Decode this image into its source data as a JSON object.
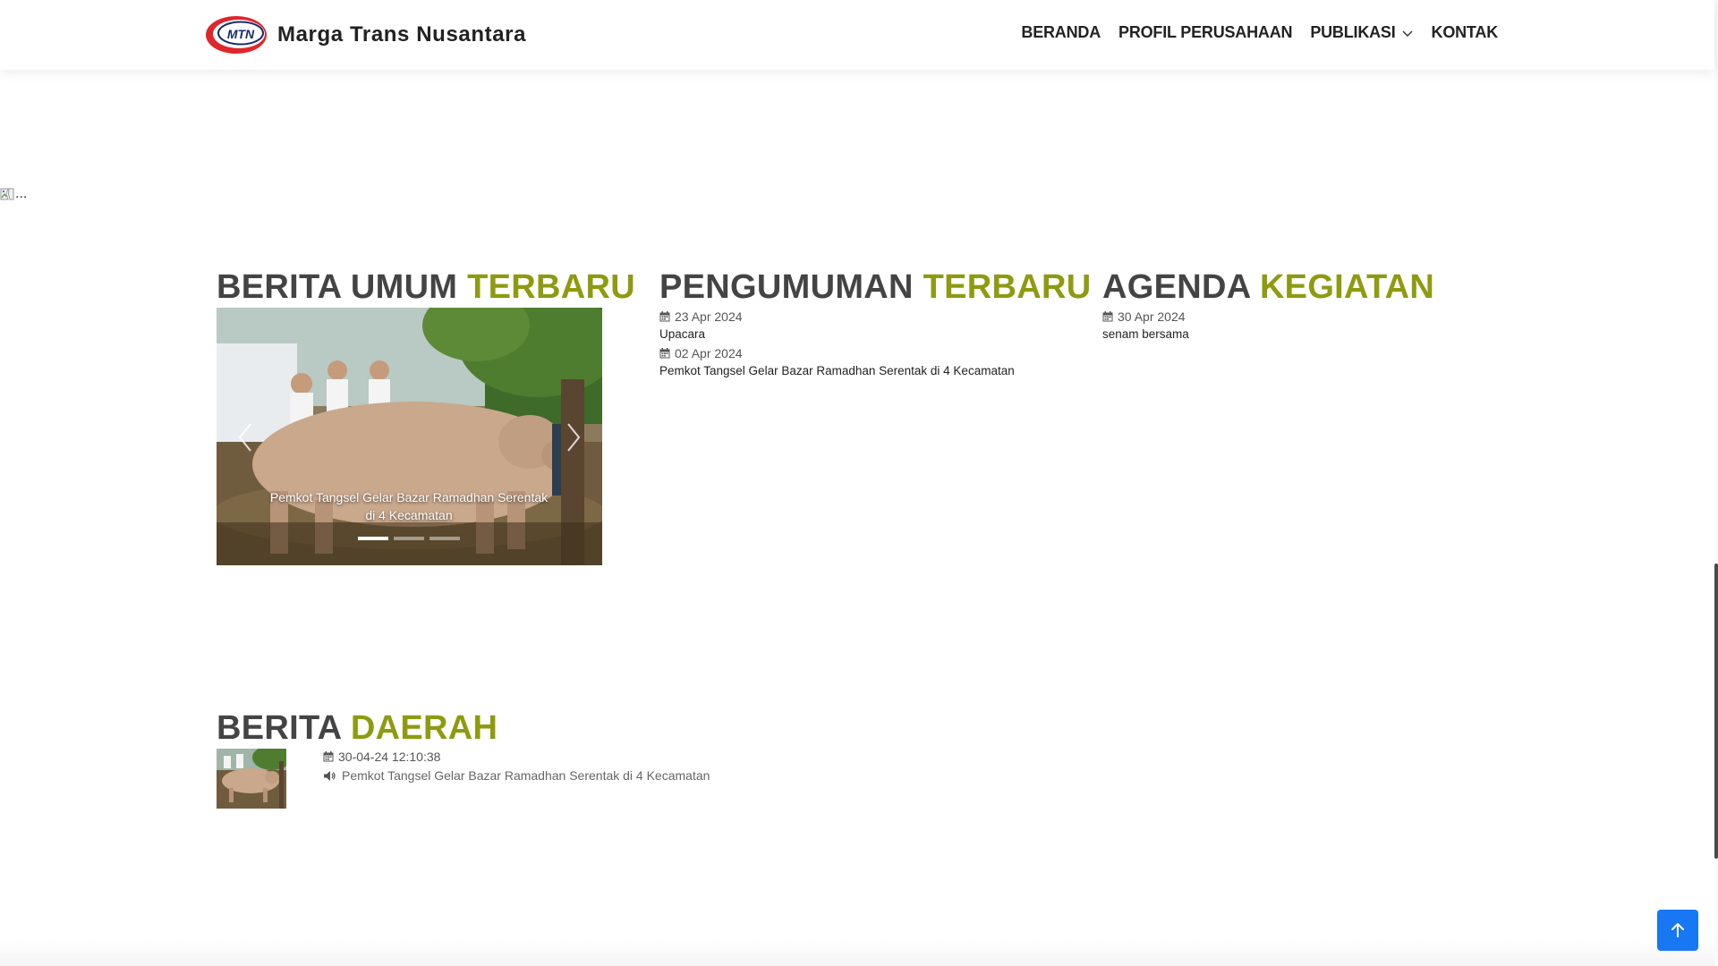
{
  "header": {
    "logo_text": "MTN",
    "brand": "Marga Trans Nusantara",
    "nav": [
      {
        "label": "BERANDA"
      },
      {
        "label": "PROFIL PERUSAHAAN"
      },
      {
        "label": "PUBLIKASI",
        "icon": "chevron-down-icon"
      },
      {
        "label": "KONTAK"
      }
    ]
  },
  "banner": {
    "alt_text": "..."
  },
  "berita_umum": {
    "title_main": "BERITA UMUM",
    "title_highlight": "TERBARU",
    "carousel": {
      "caption": "Pemkot Tangsel Gelar Bazar Ramadhan Serentak di 4 Kecamatan",
      "slide_count": 3,
      "active_index": 0
    }
  },
  "pengumuman": {
    "title_main": "PENGUMUMAN",
    "title_highlight": "TERBARU",
    "items": [
      {
        "date": "23 Apr 2024",
        "text": "Upacara"
      },
      {
        "date": "02 Apr 2024",
        "text": "Pemkot Tangsel Gelar Bazar Ramadhan Serentak di 4 Kecamatan"
      }
    ]
  },
  "agenda": {
    "title_main": "AGENDA",
    "title_highlight": "KEGIATAN",
    "items": [
      {
        "date": "30 Apr 2024",
        "text": "senam bersama"
      }
    ]
  },
  "berita_daerah": {
    "title_main": "BERITA",
    "title_highlight": "DAERAH",
    "items": [
      {
        "datetime": "30-04-24 12:10:38",
        "title": "Pemkot Tangsel Gelar Bazar Ramadhan Serentak di 4 Kecamatan"
      }
    ]
  },
  "colors": {
    "accent": "#8e9b10",
    "heading": "#444444",
    "back_to_top": "#1877f2",
    "logo_red": "#e0262b"
  }
}
